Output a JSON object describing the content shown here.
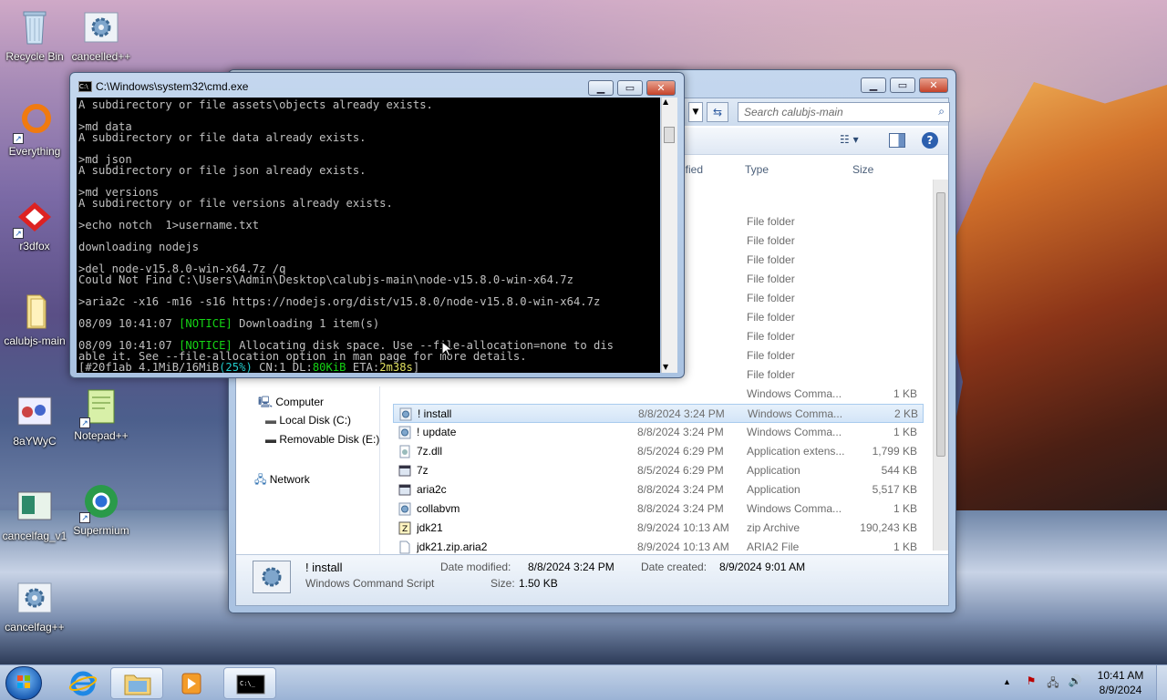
{
  "desktop": {
    "icons": [
      {
        "label": "Recycle Bin",
        "icon": "recycle-bin-icon"
      },
      {
        "label": "cancelled++",
        "icon": "script-gear-icon"
      },
      {
        "label": "Everything",
        "icon": "everything-search-icon"
      },
      {
        "label": "r3dfox",
        "icon": "r3dfox-browser-icon"
      },
      {
        "label": "calubjs-main",
        "icon": "folder-icon"
      },
      {
        "label": "8aYWyC",
        "icon": "image-file-icon"
      },
      {
        "label": "Notepad++",
        "icon": "notepadpp-icon"
      },
      {
        "label": "cancelfag_v1",
        "icon": "image-file-icon"
      },
      {
        "label": "Supermium",
        "icon": "supermium-browser-icon"
      },
      {
        "label": "cancelfag++",
        "icon": "script-gear-icon"
      }
    ]
  },
  "cmd": {
    "title": "C:\\Windows\\system32\\cmd.exe",
    "lines": [
      "A subdirectory or file assets\\objects already exists.",
      "",
      ">md data",
      "A subdirectory or file data already exists.",
      "",
      ">md json",
      "A subdirectory or file json already exists.",
      "",
      ">md versions",
      "A subdirectory or file versions already exists.",
      "",
      ">echo notch  1>username.txt",
      "",
      "downloading nodejs",
      "",
      ">del node-v15.8.0-win-x64.7z /q",
      "Could Not Find C:\\Users\\Admin\\Desktop\\calubjs-main\\node-v15.8.0-win-x64.7z",
      "",
      ">aria2c -x16 -m16 -s16 https://nodejs.org/dist/v15.8.0/node-v15.8.0-win-x64.7z",
      ""
    ],
    "notice1": {
      "ts": "08/09 10:41:07 ",
      "tag": "[NOTICE]",
      "text": " Downloading 1 item(s)"
    },
    "notice2": {
      "ts": "08/09 10:41:07 ",
      "tag": "[NOTICE]",
      "text": " Allocating disk space. Use --file-allocation=none to dis"
    },
    "notice2b": "able it. See --file-allocation option in man page for more details.",
    "progress": {
      "pre": "[#20f1ab 4.1MiB/16MiB",
      "pct": "(25%)",
      "mid": " CN:1 DL:",
      "dl": "80KiB",
      "eta_lbl": " ETA:",
      "eta": "2m38s",
      "post": "]"
    }
  },
  "explorer": {
    "search_placeholder": "Search calubjs-main",
    "columns": {
      "modified": "ified",
      "type": "Type",
      "size": "Size"
    },
    "rows": [
      {
        "name": "",
        "date": ":01 AM",
        "type": "File folder",
        "size": "",
        "icon": "folder-icon"
      },
      {
        "name": "",
        "date": "0:34 AM",
        "type": "File folder",
        "size": "",
        "icon": "folder-icon"
      },
      {
        "name": "",
        "date": "0:26 AM",
        "type": "File folder",
        "size": "",
        "icon": "folder-icon"
      },
      {
        "name": "",
        "date": "0:14 AM",
        "type": "File folder",
        "size": "",
        "icon": "folder-icon"
      },
      {
        "name": "",
        "date": "0:12 AM",
        "type": "File folder",
        "size": "",
        "icon": "folder-icon"
      },
      {
        "name": "",
        "date": "0:12 AM",
        "type": "File folder",
        "size": "",
        "icon": "folder-icon"
      },
      {
        "name": "",
        "date": ":26 AM",
        "type": "File folder",
        "size": "",
        "icon": "folder-icon"
      },
      {
        "name": "",
        "date": "7:51 PM",
        "type": "File folder",
        "size": "",
        "icon": "folder-icon"
      },
      {
        "name": "",
        "date": "0:14 AM",
        "type": "File folder",
        "size": "",
        "icon": "folder-icon"
      },
      {
        "name": "",
        "date": "",
        "type": "Windows Comma...",
        "size": "1 KB",
        "icon": "script-gear-icon"
      },
      {
        "name": "! install",
        "date": "8/8/2024 3:24 PM",
        "type": "Windows Comma...",
        "size": "2 KB",
        "icon": "script-gear-icon",
        "selected": true
      },
      {
        "name": "! update",
        "date": "8/8/2024 3:24 PM",
        "type": "Windows Comma...",
        "size": "1 KB",
        "icon": "script-gear-icon"
      },
      {
        "name": "7z.dll",
        "date": "8/5/2024 6:29 PM",
        "type": "Application extens...",
        "size": "1,799 KB",
        "icon": "dll-file-icon"
      },
      {
        "name": "7z",
        "date": "8/5/2024 6:29 PM",
        "type": "Application",
        "size": "544 KB",
        "icon": "application-icon"
      },
      {
        "name": "aria2c",
        "date": "8/8/2024 3:24 PM",
        "type": "Application",
        "size": "5,517 KB",
        "icon": "application-icon"
      },
      {
        "name": "collabvm",
        "date": "8/8/2024 3:24 PM",
        "type": "Windows Comma...",
        "size": "1 KB",
        "icon": "script-gear-icon"
      },
      {
        "name": "jdk21",
        "date": "8/9/2024 10:13 AM",
        "type": "zip Archive",
        "size": "190,243 KB",
        "icon": "archive-icon"
      },
      {
        "name": "jdk21.zip.aria2",
        "date": "8/9/2024 10:13 AM",
        "type": "ARIA2 File",
        "size": "1 KB",
        "icon": "file-icon"
      },
      {
        "name": "node-v15.8.0-win-x64",
        "date": "8/9/2024 10:41 AM",
        "type": "7z Archive",
        "size": "16,914 KB",
        "icon": "archive-icon"
      },
      {
        "name": "node-v15.8.0-win-x64.7z.aria2",
        "date": "8/9/2024 10:41 AM",
        "type": "ARIA2 File",
        "size": "1 KB",
        "icon": "file-icon"
      }
    ],
    "nav": {
      "computer": "Computer",
      "local_disk": "Local Disk (C:)",
      "removable": "Removable Disk (E:)",
      "network": "Network"
    },
    "details": {
      "name": "! install",
      "type": "Windows Command Script",
      "modified_label": "Date modified:",
      "modified": "8/8/2024 3:24 PM",
      "created_label": "Date created:",
      "created": "8/9/2024 9:01 AM",
      "size_label": "Size:",
      "size": "1.50 KB"
    }
  },
  "taskbar": {
    "time": "10:41 AM",
    "date": "8/9/2024"
  }
}
